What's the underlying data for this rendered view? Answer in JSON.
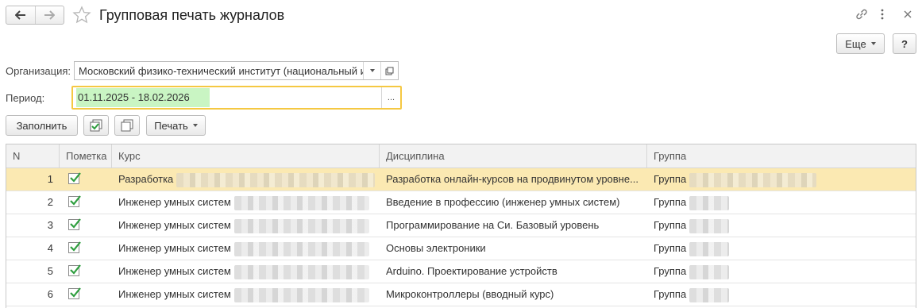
{
  "window": {
    "title": "Групповая печать журналов",
    "more_label": "Еще",
    "help_label": "?"
  },
  "form": {
    "organization_label": "Организация:",
    "organization_value": "Московский физико-технический институт (национальный ис",
    "period_label": "Период:",
    "period_value": "01.11.2025 - 18.02.2026",
    "period_btn": "..."
  },
  "toolbar": {
    "fill_label": "Заполнить",
    "print_label": "Печать"
  },
  "table": {
    "headers": [
      "N",
      "Пометка",
      "Курс",
      "Дисциплина",
      "Группа"
    ],
    "rows": [
      {
        "n": "1",
        "course": "Разработка",
        "discipline": "Разработка онлайн-курсов на продвинутом уровне...",
        "group": "Группа"
      },
      {
        "n": "2",
        "course": "Инженер умных систем",
        "discipline": "Введение в профессию (инженер умных систем)",
        "group": "Группа"
      },
      {
        "n": "3",
        "course": "Инженер умных систем",
        "discipline": "Программирование на Си. Базовый уровень",
        "group": "Группа"
      },
      {
        "n": "4",
        "course": "Инженер умных систем",
        "discipline": "Основы электроники",
        "group": "Группа"
      },
      {
        "n": "5",
        "course": "Инженер умных систем",
        "discipline": "Arduino. Проектирование устройств",
        "group": "Группа"
      },
      {
        "n": "6",
        "course": "Инженер умных систем",
        "discipline": "Микроконтроллеры (вводный курс)",
        "group": "Группа"
      }
    ]
  },
  "colors": {
    "selected_row": "#fbe9b2",
    "period_highlight": "#c9f5c3",
    "focus_border": "#f5c842",
    "check_green": "#2e9e3e"
  }
}
